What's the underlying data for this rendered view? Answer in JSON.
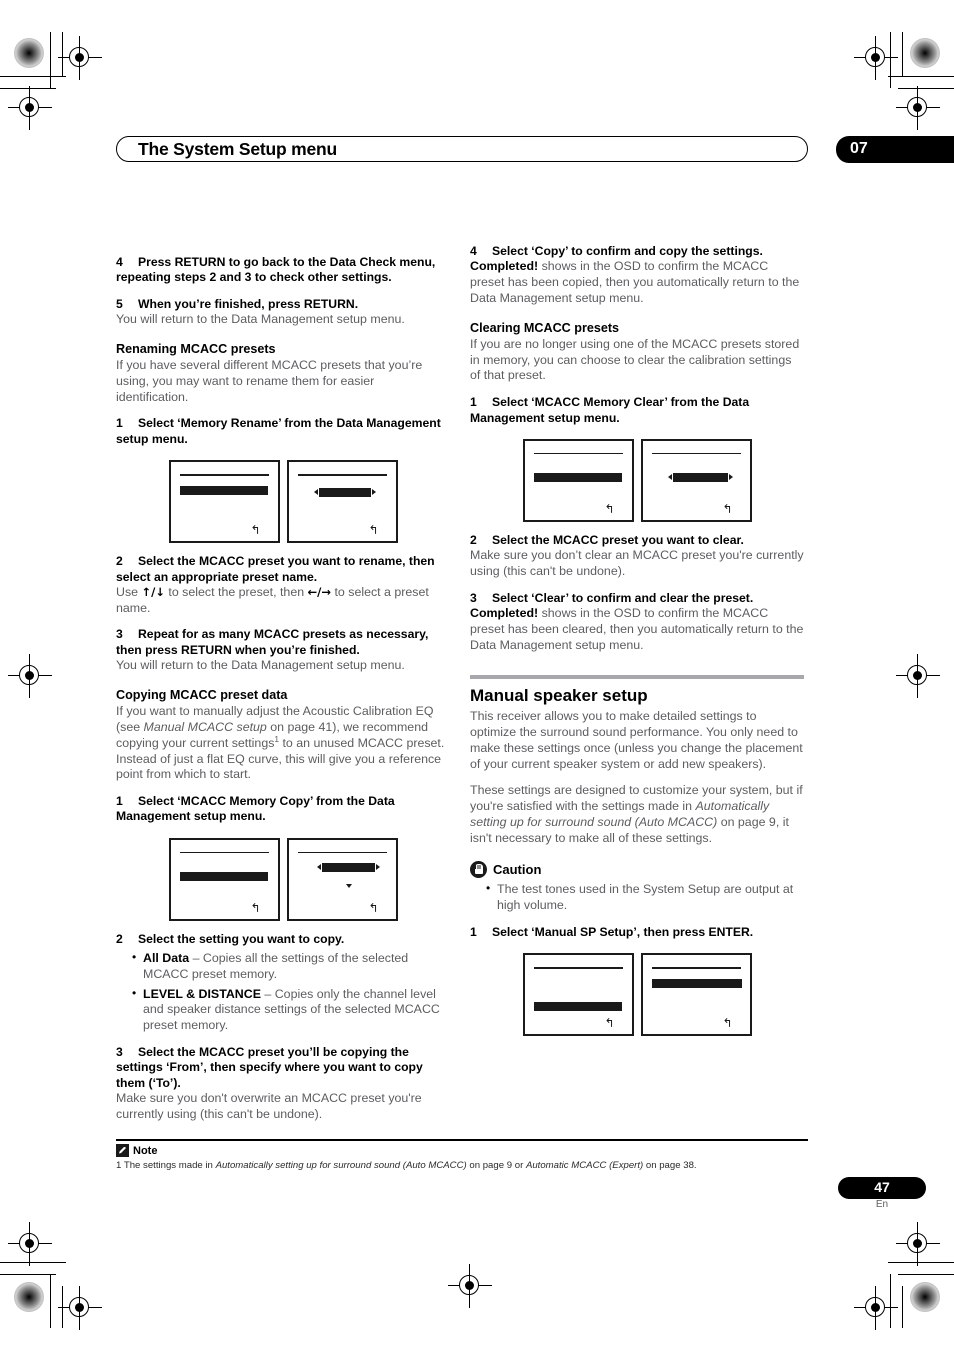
{
  "header": {
    "title": "The System Setup menu",
    "chapter": "07"
  },
  "left_column": {
    "step4": {
      "num": "4",
      "label": "Press RETURN to go back to the Data Check menu, repeating steps 2 and 3 to check other settings."
    },
    "step5": {
      "num": "5",
      "label": "When you’re finished, press RETURN."
    },
    "step5_body": "You will return to the Data Management setup menu.",
    "renaming_heading": "Renaming MCACC presets",
    "renaming_body": "If you have several different MCACC presets that you’re using, you may want to rename them for easier identification.",
    "rename_step1": {
      "num": "1",
      "label": "Select ‘Memory Rename’ from the Data Management setup menu."
    },
    "rename_step2": {
      "num": "2",
      "label": "Select the MCACC preset you want to rename, then select an appropriate preset name."
    },
    "rename_step2_body_a": "Use ",
    "rename_step2_arrows1": "↑/↓",
    "rename_step2_body_b": " to select the preset, then ",
    "rename_step2_arrows2": "←/→",
    "rename_step2_body_c": " to select a preset name.",
    "rename_step3": {
      "num": "3",
      "label": "Repeat for as many MCACC presets as necessary, then press RETURN when you’re finished."
    },
    "rename_step3_body": "You will return to the Data Management setup menu.",
    "copying_heading": "Copying MCACC preset data",
    "copying_body_a": "If you want to manually adjust the Acoustic Calibration EQ (see ",
    "copying_body_italic": "Manual MCACC setup",
    "copying_body_b": " on page 41), we recommend copying your current settings",
    "copying_footnote_ref": "1",
    "copying_body_c": " to an unused MCACC preset. Instead of just a flat EQ curve, this will give you a reference point from which to start.",
    "copy_step1": {
      "num": "1",
      "label": "Select ‘MCACC Memory Copy’ from the Data Management setup menu."
    },
    "copy_step2": {
      "num": "2",
      "label": "Select the setting you want to copy."
    },
    "copy_bullets": [
      {
        "term": "All Data",
        "dash": " – ",
        "desc": "Copies all the settings of the selected MCACC preset memory."
      },
      {
        "term": "LEVEL & DISTANCE",
        "dash": " – ",
        "desc": "Copies only the channel level and speaker distance settings of the selected MCACC preset memory."
      }
    ],
    "copy_step3": {
      "num": "3",
      "label": "Select the MCACC preset you’ll be copying the settings ‘From’, then specify where you want to copy them (‘To’)."
    },
    "copy_step3_body": "Make sure you don't overwrite an MCACC preset you're currently using (this can't be undone)."
  },
  "right_column": {
    "step4": {
      "num": "4",
      "label": "Select ‘Copy’ to confirm and copy the settings."
    },
    "step4_bold": "Completed!",
    "step4_body": " shows in the OSD to confirm the MCACC preset has been copied, then you automatically return to the Data Management setup menu.",
    "clearing_heading": "Clearing MCACC presets",
    "clearing_body": "If you are no longer using one of the MCACC presets stored in memory, you can choose to clear the calibration settings of that preset.",
    "clear_step1": {
      "num": "1",
      "label": "Select ‘MCACC Memory Clear’ from the Data Management setup menu."
    },
    "clear_step2": {
      "num": "2",
      "label": "Select the MCACC preset you want to clear."
    },
    "clear_step2_body": "Make sure you don’t clear an MCACC preset you're currently using (this can't be undone).",
    "clear_step3": {
      "num": "3",
      "label": "Select ‘Clear’ to confirm and clear the preset."
    },
    "clear_step3_bold": "Completed!",
    "clear_step3_body": " shows in the OSD to confirm the MCACC preset has been cleared, then you automatically return to the Data Management setup menu.",
    "section_heading": "Manual speaker setup",
    "section_body_1": "This receiver allows you to make detailed settings to optimize the surround sound performance. You only need to make these settings once (unless you change the placement of your current speaker system or add new speakers).",
    "section_body_2_a": "These settings are designed to customize your system, but if you're satisfied with the settings made in ",
    "section_body_2_italic": "Automatically setting up for surround sound (Auto MCACC)",
    "section_body_2_b": " on page 9, it isn't necessary to make all of these settings.",
    "caution_label": "Caution",
    "caution_bullet": "The test tones used in the System Setup are output at high volume.",
    "manual_step1": {
      "num": "1",
      "label": "Select ‘Manual SP Setup’, then press ENTER."
    }
  },
  "footnote": {
    "note_label": "Note",
    "marker": "1",
    "text_a": " The settings made in ",
    "italic_1": "Automatically setting up for surround sound (Auto MCACC)",
    "text_b": " on page 9 or ",
    "italic_2": "Automatic MCACC (Expert)",
    "text_c": " on page 38."
  },
  "page_footer": {
    "page_number": "47",
    "language": "En"
  },
  "icons": {
    "return_glyph": "↰",
    "caution_icon": "hand-palm-icon",
    "note_icon": "pencil-note-icon"
  },
  "colors": {
    "ink": "#231f20",
    "body_text": "#5d5d60",
    "rule": "#a6a8ab",
    "black": "#000000"
  }
}
